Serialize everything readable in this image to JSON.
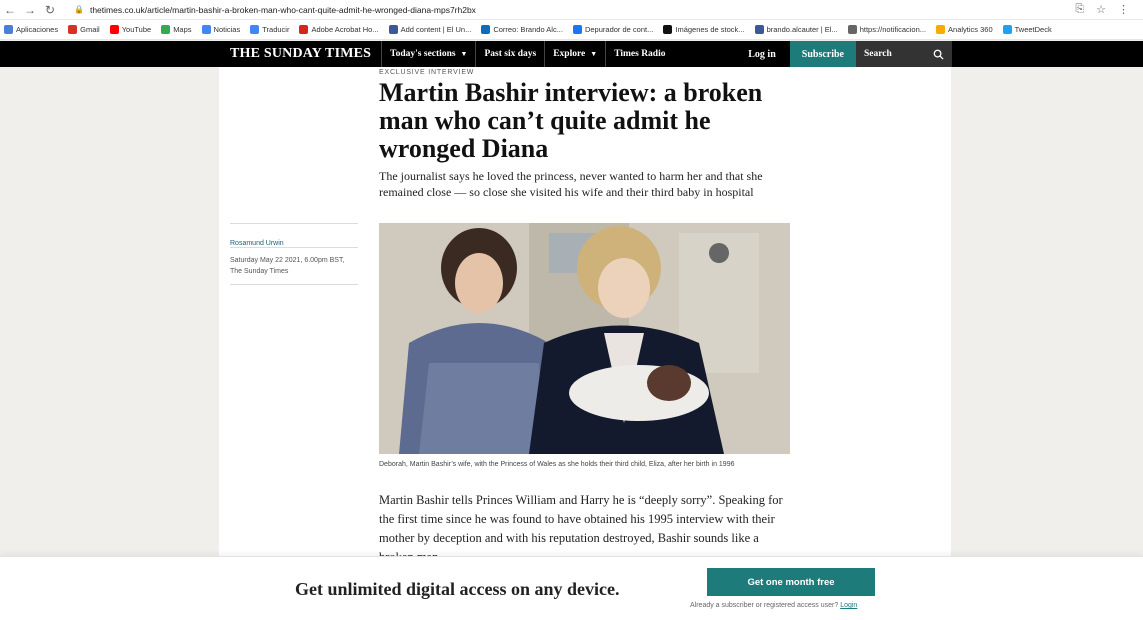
{
  "browser": {
    "url": "thetimes.co.uk/article/martin-bashir-a-broken-man-who-cant-quite-admit-he-wronged-diana-mps7rh2bx",
    "bookmarks": [
      {
        "label": "Aplicaciones",
        "color": "#4a7fd6"
      },
      {
        "label": "Gmail",
        "color": "#d93025"
      },
      {
        "label": "YouTube",
        "color": "#ff0000"
      },
      {
        "label": "Maps",
        "color": "#34a853"
      },
      {
        "label": "Noticias",
        "color": "#4285f4"
      },
      {
        "label": "Traducir",
        "color": "#4285f4"
      },
      {
        "label": "Adobe Acrobat Ho...",
        "color": "#d9261c"
      },
      {
        "label": "Add content | El Un...",
        "color": "#3b5998"
      },
      {
        "label": "Correo: Brando Alc...",
        "color": "#0f6cbd"
      },
      {
        "label": "Depurador de cont...",
        "color": "#1877f2"
      },
      {
        "label": "Imágenes de stock...",
        "color": "#111111"
      },
      {
        "label": "brando.alcauter | El...",
        "color": "#3b5998"
      },
      {
        "label": "https://notificacion...",
        "color": "#666666"
      },
      {
        "label": "Analytics 360",
        "color": "#f9ab00"
      },
      {
        "label": "TweetDeck",
        "color": "#1da1f2"
      }
    ]
  },
  "header": {
    "brand": "THE SUNDAY TIMES",
    "nav": [
      "Today's sections",
      "Past six days",
      "Explore",
      "Times Radio"
    ],
    "login": "Log in",
    "subscribe": "Subscribe",
    "search": "Search"
  },
  "article": {
    "kicker": "EXCLUSIVE INTERVIEW",
    "headline": "Martin Bashir interview: a broken man who can’t quite admit he wronged Diana",
    "standfirst": "The journalist says he loved the princess, never wanted to harm her and that she remained close — so close she visited his wife and their third baby in hospital",
    "author": "Rosamund Urwin",
    "date": "Saturday May 22 2021, 6.00pm BST,",
    "publication": "The Sunday Times",
    "caption": "Deborah, Martin Bashir’s wife, with the Princess of Wales as she holds their third child, Eliza, after her birth in 1996",
    "body": "Martin Bashir tells Princes William and Harry he is “deeply sorry”. Speaking for the first time since he was found to have obtained his 1995 interview with their mother by deception and with his reputation destroyed, Bashir sounds like a broken man"
  },
  "paywall": {
    "title": "Get unlimited digital access on any device.",
    "cta": "Get one month free",
    "note": "Already a subscriber or registered access user?",
    "login": "Login"
  }
}
